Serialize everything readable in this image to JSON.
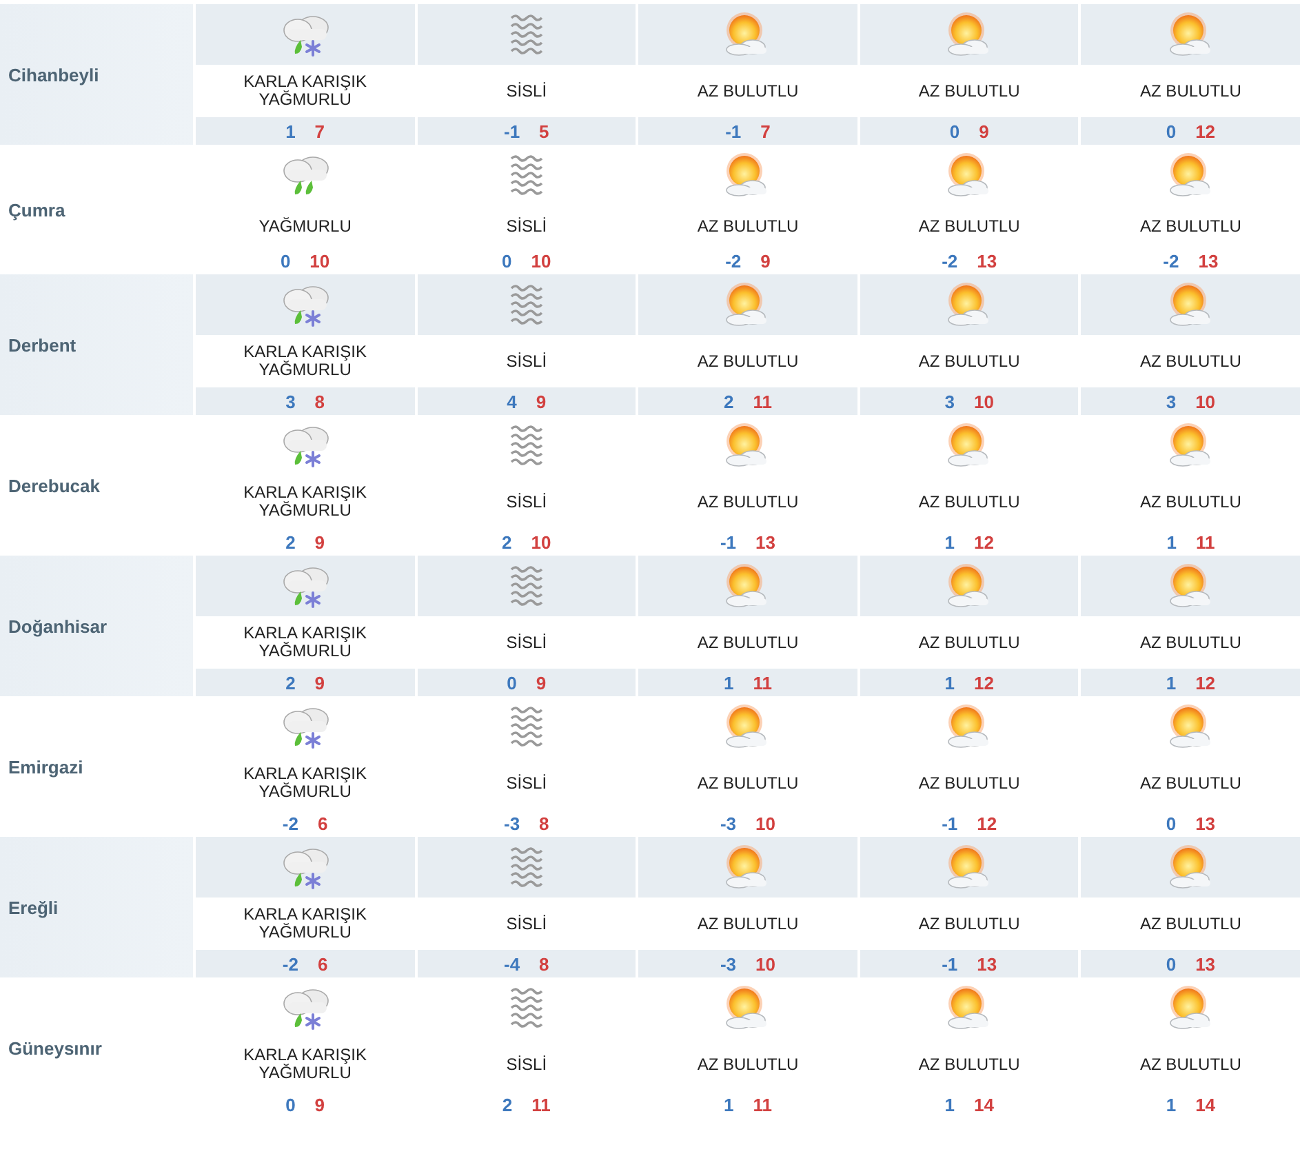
{
  "forecast": [
    {
      "name": "Cihanbeyli",
      "days": [
        {
          "kind": "sleet",
          "condition": "KARLA KARIŞIK YAĞMURLU",
          "low": "1",
          "high": "7"
        },
        {
          "kind": "fog",
          "condition": "SİSLİ",
          "low": "-1",
          "high": "5"
        },
        {
          "kind": "partly_sunny",
          "condition": "AZ BULUTLU",
          "low": "-1",
          "high": "7"
        },
        {
          "kind": "partly_sunny",
          "condition": "AZ BULUTLU",
          "low": "0",
          "high": "9"
        },
        {
          "kind": "partly_sunny",
          "condition": "AZ BULUTLU",
          "low": "0",
          "high": "12"
        }
      ]
    },
    {
      "name": "Çumra",
      "days": [
        {
          "kind": "rain",
          "condition": "YAĞMURLU",
          "low": "0",
          "high": "10"
        },
        {
          "kind": "fog",
          "condition": "SİSLİ",
          "low": "0",
          "high": "10"
        },
        {
          "kind": "partly_sunny",
          "condition": "AZ BULUTLU",
          "low": "-2",
          "high": "9"
        },
        {
          "kind": "partly_sunny",
          "condition": "AZ BULUTLU",
          "low": "-2",
          "high": "13"
        },
        {
          "kind": "partly_sunny",
          "condition": "AZ BULUTLU",
          "low": "-2",
          "high": "13"
        }
      ]
    },
    {
      "name": "Derbent",
      "days": [
        {
          "kind": "sleet",
          "condition": "KARLA KARIŞIK YAĞMURLU",
          "low": "3",
          "high": "8"
        },
        {
          "kind": "fog",
          "condition": "SİSLİ",
          "low": "4",
          "high": "9"
        },
        {
          "kind": "partly_sunny",
          "condition": "AZ BULUTLU",
          "low": "2",
          "high": "11"
        },
        {
          "kind": "partly_sunny",
          "condition": "AZ BULUTLU",
          "low": "3",
          "high": "10"
        },
        {
          "kind": "partly_sunny",
          "condition": "AZ BULUTLU",
          "low": "3",
          "high": "10"
        }
      ]
    },
    {
      "name": "Derebucak",
      "days": [
        {
          "kind": "sleet",
          "condition": "KARLA KARIŞIK YAĞMURLU",
          "low": "2",
          "high": "9"
        },
        {
          "kind": "fog",
          "condition": "SİSLİ",
          "low": "2",
          "high": "10"
        },
        {
          "kind": "partly_sunny",
          "condition": "AZ BULUTLU",
          "low": "-1",
          "high": "13"
        },
        {
          "kind": "partly_sunny",
          "condition": "AZ BULUTLU",
          "low": "1",
          "high": "12"
        },
        {
          "kind": "partly_sunny",
          "condition": "AZ BULUTLU",
          "low": "1",
          "high": "11"
        }
      ]
    },
    {
      "name": "Doğanhisar",
      "days": [
        {
          "kind": "sleet",
          "condition": "KARLA KARIŞIK YAĞMURLU",
          "low": "2",
          "high": "9"
        },
        {
          "kind": "fog",
          "condition": "SİSLİ",
          "low": "0",
          "high": "9"
        },
        {
          "kind": "partly_sunny",
          "condition": "AZ BULUTLU",
          "low": "1",
          "high": "11"
        },
        {
          "kind": "partly_sunny",
          "condition": "AZ BULUTLU",
          "low": "1",
          "high": "12"
        },
        {
          "kind": "partly_sunny",
          "condition": "AZ BULUTLU",
          "low": "1",
          "high": "12"
        }
      ]
    },
    {
      "name": "Emirgazi",
      "days": [
        {
          "kind": "sleet",
          "condition": "KARLA KARIŞIK YAĞMURLU",
          "low": "-2",
          "high": "6"
        },
        {
          "kind": "fog",
          "condition": "SİSLİ",
          "low": "-3",
          "high": "8"
        },
        {
          "kind": "partly_sunny",
          "condition": "AZ BULUTLU",
          "low": "-3",
          "high": "10"
        },
        {
          "kind": "partly_sunny",
          "condition": "AZ BULUTLU",
          "low": "-1",
          "high": "12"
        },
        {
          "kind": "partly_sunny",
          "condition": "AZ BULUTLU",
          "low": "0",
          "high": "13"
        }
      ]
    },
    {
      "name": "Ereğli",
      "days": [
        {
          "kind": "sleet",
          "condition": "KARLA KARIŞIK YAĞMURLU",
          "low": "-2",
          "high": "6"
        },
        {
          "kind": "fog",
          "condition": "SİSLİ",
          "low": "-4",
          "high": "8"
        },
        {
          "kind": "partly_sunny",
          "condition": "AZ BULUTLU",
          "low": "-3",
          "high": "10"
        },
        {
          "kind": "partly_sunny",
          "condition": "AZ BULUTLU",
          "low": "-1",
          "high": "13"
        },
        {
          "kind": "partly_sunny",
          "condition": "AZ BULUTLU",
          "low": "0",
          "high": "13"
        }
      ]
    },
    {
      "name": "Güneysınır",
      "days": [
        {
          "kind": "sleet",
          "condition": "KARLA KARIŞIK YAĞMURLU",
          "low": "0",
          "high": "9"
        },
        {
          "kind": "fog",
          "condition": "SİSLİ",
          "low": "2",
          "high": "11"
        },
        {
          "kind": "partly_sunny",
          "condition": "AZ BULUTLU",
          "low": "1",
          "high": "11"
        },
        {
          "kind": "partly_sunny",
          "condition": "AZ BULUTLU",
          "low": "1",
          "high": "14"
        },
        {
          "kind": "partly_sunny",
          "condition": "AZ BULUTLU",
          "low": "1",
          "high": "14"
        }
      ]
    }
  ]
}
